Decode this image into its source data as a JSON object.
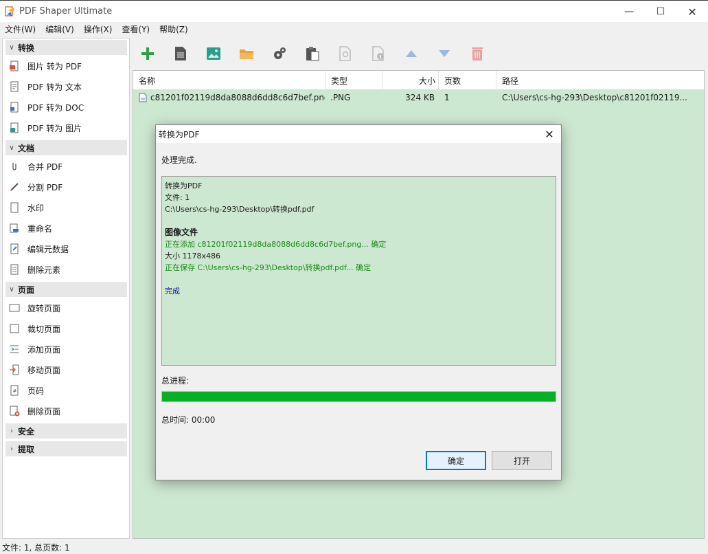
{
  "window": {
    "title": "PDF Shaper Ultimate",
    "minimize_icon": "minimize-icon",
    "maximize_icon": "maximize-icon",
    "close_icon": "close-icon"
  },
  "menu": [
    "文件(W)",
    "编辑(V)",
    "操作(X)",
    "查看(Y)",
    "帮助(Z)"
  ],
  "sidebar": {
    "sections": [
      {
        "label": "转换",
        "expanded": true,
        "items": [
          {
            "label": "图片 转为 PDF",
            "icon": "image-to-pdf-icon"
          },
          {
            "label": "PDF 转为 文本",
            "icon": "text-document-icon"
          },
          {
            "label": "PDF 转为 DOC",
            "icon": "doc-icon"
          },
          {
            "label": "PDF 转为 图片",
            "icon": "pdf-to-image-icon"
          }
        ]
      },
      {
        "label": "文档",
        "expanded": true,
        "items": [
          {
            "label": "合并 PDF",
            "icon": "paperclip-icon"
          },
          {
            "label": "分割 PDF",
            "icon": "split-icon"
          },
          {
            "label": "水印",
            "icon": "watermark-icon"
          },
          {
            "label": "重命名",
            "icon": "rename-icon"
          },
          {
            "label": "编辑元数据",
            "icon": "metadata-icon"
          },
          {
            "label": "删除元素",
            "icon": "remove-elements-icon"
          }
        ]
      },
      {
        "label": "页面",
        "expanded": true,
        "items": [
          {
            "label": "旋转页面",
            "icon": "rotate-page-icon"
          },
          {
            "label": "裁切页面",
            "icon": "crop-page-icon"
          },
          {
            "label": "添加页面",
            "icon": "add-page-icon"
          },
          {
            "label": "移动页面",
            "icon": "move-page-icon"
          },
          {
            "label": "页码",
            "icon": "page-number-icon"
          },
          {
            "label": "删除页面",
            "icon": "delete-page-icon"
          }
        ]
      },
      {
        "label": "安全",
        "expanded": false,
        "items": []
      },
      {
        "label": "提取",
        "expanded": false,
        "items": []
      }
    ]
  },
  "toolbar": {
    "buttons": [
      {
        "name": "add-icon",
        "color": "#2ea043"
      },
      {
        "name": "document-icon",
        "color": "#555555"
      },
      {
        "name": "image-icon",
        "color": "#2a9d8f"
      },
      {
        "name": "folder-icon",
        "color": "#e8a33d"
      },
      {
        "name": "settings-icon",
        "color": "#555555"
      },
      {
        "name": "clipboard-icon",
        "color": "#555555"
      },
      {
        "name": "preview-icon",
        "color": "#bbbbbb"
      },
      {
        "name": "info-icon",
        "color": "#bbbbbb"
      },
      {
        "name": "move-up-icon",
        "color": "#9cb8e0"
      },
      {
        "name": "move-down-icon",
        "color": "#9cb8e0"
      },
      {
        "name": "delete-icon",
        "color": "#e8a0a0"
      }
    ]
  },
  "file_list": {
    "columns": [
      "名称",
      "类型",
      "大小",
      "页数",
      "路径"
    ],
    "rows": [
      {
        "name": "c81201f02119d8da8088d6dd8c6d7bef.png",
        "type": ".PNG",
        "size": "324 KB",
        "pages": "1",
        "path": "C:\\Users\\cs-hg-293\\Desktop\\c81201f02119..."
      }
    ]
  },
  "dialog": {
    "title": "转换为PDF",
    "status": "处理完成.",
    "log": [
      {
        "text": "转换为PDF",
        "style": "normal"
      },
      {
        "text": "文件: 1",
        "style": "normal"
      },
      {
        "text": "C:\\Users\\cs-hg-293\\Desktop\\转换pdf.pdf",
        "style": "normal"
      },
      {
        "text": "",
        "style": "normal"
      },
      {
        "text": "图像文件",
        "style": "bold"
      },
      {
        "text": "正在添加 c81201f02119d8da8088d6dd8c6d7bef.png... 确定",
        "style": "green"
      },
      {
        "text": "大小 1178x486",
        "style": "normal"
      },
      {
        "text": "正在保存 C:\\Users\\cs-hg-293\\Desktop\\转换pdf.pdf... 确定",
        "style": "green"
      },
      {
        "text": "",
        "style": "normal"
      },
      {
        "text": "完成",
        "style": "blue"
      }
    ],
    "progress_label": "总进程:",
    "progress_value": 1.0,
    "time_label": "总时间: 00:00",
    "ok_label": "确定",
    "open_label": "打开"
  },
  "statusbar": {
    "text": "文件: 1, 总页数: 1"
  },
  "colors": {
    "list_background": "#cde8d0",
    "progress_fill": "#06b025",
    "log_green": "#138a13",
    "log_blue": "#1010a0",
    "accent": "#0078d7"
  }
}
